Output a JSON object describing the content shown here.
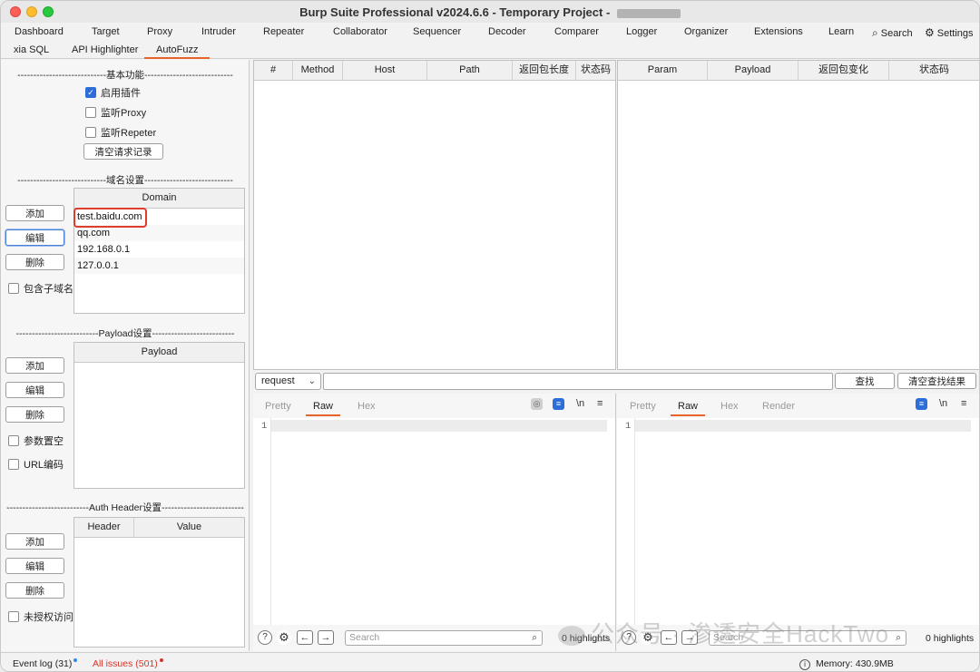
{
  "window": {
    "title": "Burp Suite Professional v2024.6.6 - Temporary Project - "
  },
  "tabs_row1": [
    "Dashboard",
    "Target",
    "Proxy",
    "Intruder",
    "Repeater",
    "Collaborator",
    "Sequencer",
    "Decoder",
    "Comparer",
    "Logger",
    "Organizer",
    "Extensions",
    "Learn"
  ],
  "tabs_row2": [
    "xia SQL",
    "API Highlighter",
    "AutoFuzz"
  ],
  "top_actions": {
    "search": "Search",
    "settings": "Settings"
  },
  "left": {
    "basic_title": "----------------------------基本功能----------------------------",
    "enable_plugin": "启用插件",
    "listen_proxy": "监听Proxy",
    "listen_repeater": "监听Repeter",
    "clear_records": "清空请求记录",
    "domain_title": "----------------------------域名设置----------------------------",
    "domain_header": "Domain",
    "domains": [
      "test.baidu.com",
      "qq.com",
      "192.168.0.1",
      "127.0.0.1"
    ],
    "add": "添加",
    "edit": "编辑",
    "delete": "删除",
    "include_subdomain": "包含子域名",
    "payload_title": "--------------------------Payload设置--------------------------",
    "payload_header": "Payload",
    "param_empty": "参数置空",
    "url_encode": "URL编码",
    "auth_title": "--------------------------Auth Header设置--------------------------",
    "auth_headers": [
      "Header",
      "Value"
    ],
    "unauth_access": "未授权访问"
  },
  "request_table": {
    "headers": [
      "#",
      "Method",
      "Host",
      "Path",
      "返回包长度",
      "状态码"
    ]
  },
  "result_table": {
    "headers": [
      "Param",
      "Payload",
      "返回包变化",
      "状态码"
    ]
  },
  "filter": {
    "select_value": "request",
    "find": "查找",
    "clear_results": "清空查找结果"
  },
  "editor_left": {
    "tabs": [
      "Pretty",
      "Raw",
      "Hex"
    ],
    "line": "1",
    "search_placeholder": "Search",
    "highlights": "0 highlights"
  },
  "editor_right": {
    "tabs": [
      "Pretty",
      "Raw",
      "Hex",
      "Render"
    ],
    "line": "1",
    "search_placeholder": "Search",
    "highlights": "0 highlights"
  },
  "status": {
    "event_log": "Event log (31)",
    "all_issues": "All issues (501)",
    "memory": "Memory: 430.9MB"
  },
  "watermark": "公众号 · 渗透安全HackTwo",
  "colors": {
    "accent_tab": "#e8622c",
    "highlight_box": "#e03c2c",
    "checkbox": "#2d6ed8",
    "issues_red": "#d9342b"
  }
}
